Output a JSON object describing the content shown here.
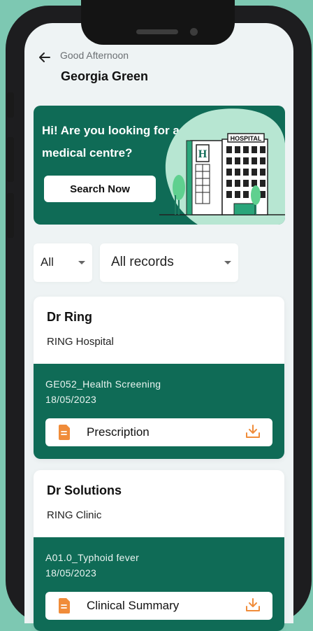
{
  "header": {
    "greeting": "Good Afternoon",
    "user_name": "Georgia Green"
  },
  "banner": {
    "message": "Hi! Are you looking for a medical centre?",
    "search_label": "Search Now",
    "hospital_sign": "HOSPITAL",
    "hospital_letter": "H"
  },
  "filters": {
    "type_value": "All",
    "records_value": "All records"
  },
  "records": [
    {
      "doctor": "Dr Ring",
      "facility": "RING Hospital",
      "diagnosis": "GE052_Health Screening",
      "date": "18/05/2023",
      "document": "Prescription"
    },
    {
      "doctor": "Dr Solutions",
      "facility": "RING Clinic",
      "diagnosis": "A01.0_Typhoid fever",
      "date": "18/05/2023",
      "document": "Clinical Summary"
    }
  ],
  "colors": {
    "primary": "#0f6b56",
    "accent": "#f08c3a",
    "background": "#7dc8b2"
  },
  "icons": {
    "back": "arrow-left-icon",
    "document": "document-icon",
    "download": "download-icon",
    "dropdown": "chevron-down-icon"
  }
}
